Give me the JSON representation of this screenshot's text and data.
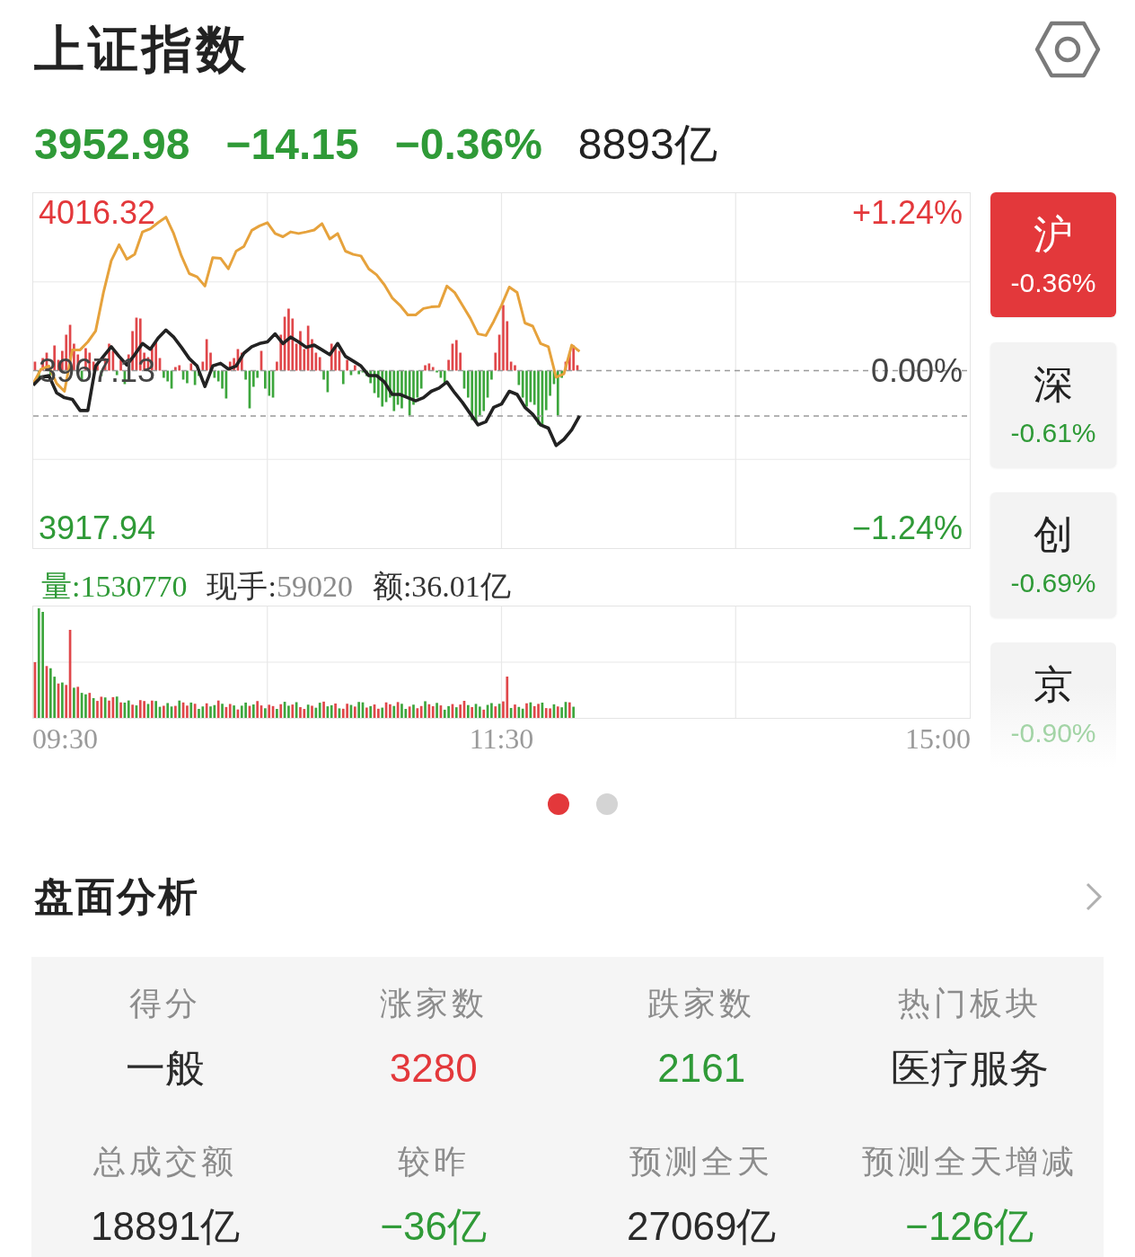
{
  "header": {
    "title": "上证指数"
  },
  "quote": {
    "color": "#2f9a37",
    "price": "3952.98",
    "change": "−14.15",
    "change_pct": "−0.36%",
    "turnover": "8893亿"
  },
  "main_chart": {
    "chart_data": {
      "type": "line",
      "grid": true,
      "ylim": [
        3911.78,
        4022.49
      ],
      "yticks": [
        {
          "value": 4016.32,
          "label": "4016.32"
        },
        {
          "value": 3967.13,
          "label": "3967.13"
        },
        {
          "value": 3917.94,
          "label": "3917.94"
        }
      ],
      "ref_lines": [
        {
          "axis": "y",
          "value": 3967.13
        },
        {
          "axis": "y",
          "value": 3953.0
        }
      ],
      "categories": [
        null,
        null,
        null,
        null,
        null,
        null,
        null,
        null,
        null,
        null,
        null,
        null,
        null,
        null,
        null,
        null,
        null,
        null,
        null,
        null,
        null,
        null,
        null,
        null,
        null,
        null,
        null,
        null,
        null,
        null,
        null,
        null,
        null,
        null,
        null,
        null,
        null,
        null,
        null,
        null,
        null,
        null,
        null,
        null,
        null,
        null,
        null,
        null,
        null,
        null,
        null,
        null,
        null,
        null,
        null,
        null,
        null,
        null,
        null,
        null,
        null,
        null,
        null,
        null,
        null,
        null,
        null,
        null,
        null,
        null,
        null,
        null,
        null,
        null,
        null,
        null,
        null,
        null,
        null,
        null,
        null,
        null,
        null,
        null,
        null,
        null,
        null,
        null,
        null,
        null,
        null,
        null,
        null,
        null,
        null,
        null,
        null,
        null,
        null,
        null,
        null,
        null,
        null,
        null,
        null,
        null,
        null,
        null,
        null,
        null,
        null,
        null,
        null,
        null,
        null,
        null,
        null,
        null,
        null,
        null,
        null
      ],
      "series": [
        {
          "color": "#e6a23c",
          "values": [
            3963.1,
            3967.6,
            3968.6,
            3963.1,
            3960.7,
            3973.6,
            3973.6,
            3976.1,
            3979.5,
            3991.5,
            4001.4,
            4006.4,
            4001.9,
            4003.4,
            4010.4,
            4011.4,
            4013.3,
            4015.0,
            4009.9,
            4002.9,
            3997.4,
            3996.4,
            3993.5,
            4002.4,
            4002.2,
            3998.9,
            4004.4,
            4005.9,
            4010.9,
            4012.3,
            4013.3,
            4009.9,
            4008.9,
            4010.4,
            4009.9,
            4010.4,
            4011.0,
            4013.0,
            4008.2,
            4009.9,
            4004.4,
            4003.4,
            4002.9,
            3998.9,
            3997.0,
            3993.9,
            3989.8,
            3987.5,
            3984.5,
            3984.5,
            3986.5,
            3987.0,
            3987.2,
            3993.5,
            3991.5,
            3987.5,
            3983.5,
            3978.6,
            3978.1,
            3982.5,
            3987.5,
            3993.2,
            3991.5,
            3982.0,
            3981.0,
            3975.6,
            3974.6,
            3965.1,
            3966.1,
            3975.1,
            3973.1,
            null,
            null,
            null,
            null,
            null,
            null,
            null,
            null,
            null,
            null,
            null,
            null,
            null,
            null,
            null,
            null,
            null,
            null,
            null,
            null,
            null,
            null,
            null,
            null,
            null,
            null,
            null,
            null,
            null,
            null,
            null,
            null,
            null,
            null,
            null,
            null,
            null,
            null,
            null,
            null,
            null,
            null,
            null,
            null,
            null,
            null,
            null,
            null,
            null,
            null
          ]
        },
        {
          "color": "#222222",
          "values": [
            3962.6,
            3965.1,
            3965.6,
            3960.2,
            3958.7,
            3958.2,
            3954.7,
            3954.7,
            3968.6,
            3971.6,
            3974.6,
            3971.6,
            3968.9,
            3972.1,
            3975.6,
            3973.8,
            3977.3,
            3979.8,
            3977.6,
            3974.4,
            3970.9,
            3968.6,
            3962.2,
            3968.6,
            3969.4,
            3967.6,
            3968.6,
            3972.6,
            3974.6,
            3975.6,
            3976.1,
            3978.6,
            3975.6,
            3977.6,
            3976.1,
            3974.4,
            3975.1,
            3973.6,
            3972.1,
            3975.6,
            3971.6,
            3970.1,
            3968.6,
            3965.6,
            3965.6,
            3963.6,
            3959.7,
            3959.7,
            3958.7,
            3957.7,
            3958.7,
            3960.7,
            3961.7,
            3963.6,
            3960.2,
            3957.2,
            3953.7,
            3950.2,
            3951.2,
            3955.7,
            3956.7,
            3960.7,
            3959.7,
            3955.7,
            3953.5,
            3950.2,
            3949.2,
            3943.8,
            3945.7,
            3948.7,
            3953.0,
            null,
            null,
            null,
            null,
            null,
            null,
            null,
            null,
            null,
            null,
            null,
            null,
            null,
            null,
            null,
            null,
            null,
            null,
            null,
            null,
            null,
            null,
            null,
            null,
            null,
            null,
            null,
            null,
            null,
            null,
            null,
            null,
            null,
            null,
            null,
            null,
            null,
            null,
            null,
            null,
            null,
            null,
            null,
            null,
            null,
            null,
            null,
            null,
            null,
            null
          ]
        }
      ]
    },
    "percent_labels": [
      {
        "text": "+1.24%",
        "color": "#e3383b"
      },
      {
        "text": "0.00%",
        "color": "#444444"
      },
      {
        "text": "−1.24%",
        "color": "#2f9a37"
      }
    ]
  },
  "volume_info": [
    {
      "kind": "volume",
      "label": "量:",
      "value": "1530770"
    },
    {
      "kind": "hand",
      "label": "现手:",
      "value": "59020"
    },
    {
      "kind": "amount",
      "label": "额:",
      "value": "36.01亿"
    }
  ],
  "time_axis": [
    "09:30",
    "11:30",
    "15:00"
  ],
  "index_tabs": [
    {
      "label": "沪",
      "change": "-0.36%",
      "selected": true
    },
    {
      "label": "深",
      "change": "-0.61%",
      "color": "#2f9a37",
      "selected": false
    },
    {
      "label": "创",
      "change": "-0.69%",
      "color": "#2f9a37",
      "selected": false
    },
    {
      "label": "京",
      "change": "-0.90%",
      "color": "#a3d4a6",
      "selected": false
    }
  ],
  "pager": [
    {
      "selected": true
    },
    {
      "selected": false
    }
  ],
  "analysis": {
    "title": "盘面分析",
    "items": [
      {
        "label": "得分",
        "value": "一般",
        "color": "#2a2a2a"
      },
      {
        "label": "涨家数",
        "value": "3280",
        "color": "#e3383b"
      },
      {
        "label": "跌家数",
        "value": "2161",
        "color": "#2f9a37"
      },
      {
        "label": "热门板块",
        "value": "医疗服务",
        "color": "#2a2a2a"
      },
      {
        "label": "总成交额",
        "value": "18891亿",
        "color": "#2a2a2a"
      },
      {
        "label": "较昨",
        "value": "−36亿",
        "color": "#2f9a37"
      },
      {
        "label": "预测全天",
        "value": "27069亿",
        "color": "#2a2a2a"
      },
      {
        "label": "预测全天增减",
        "value": "−126亿",
        "color": "#2f9a37"
      }
    ]
  }
}
